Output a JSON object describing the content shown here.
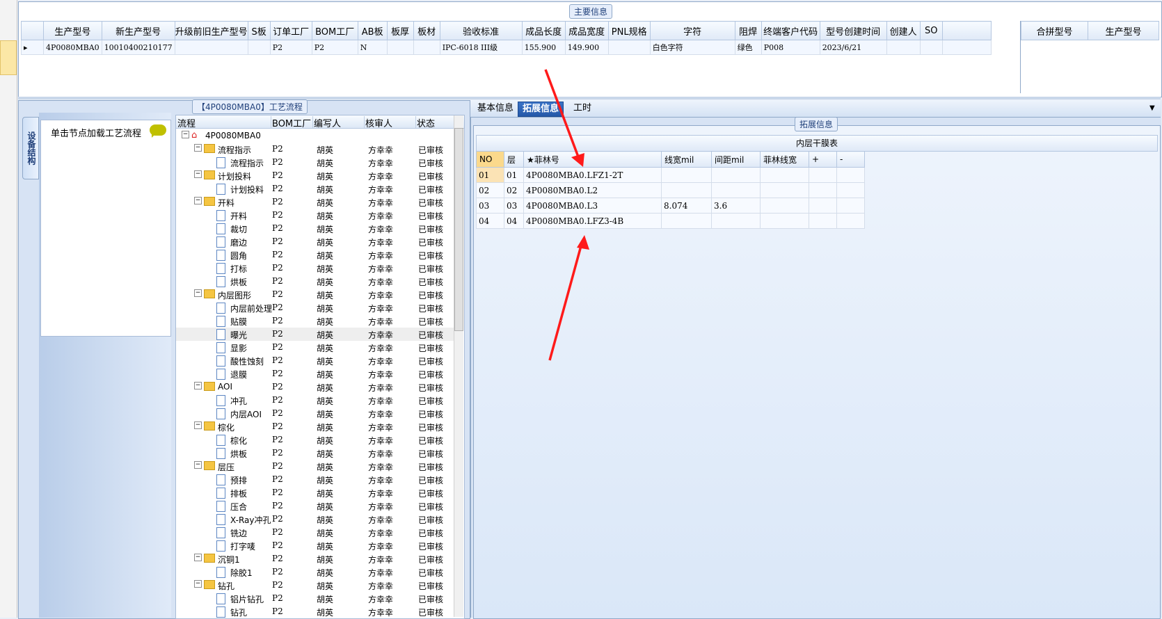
{
  "main_info": {
    "caption": "主要信息",
    "columns": [
      "生产型号",
      "新生产型号",
      "升级前旧生产型号",
      "S板",
      "订单工厂",
      "BOM工厂",
      "AB板",
      "板厚",
      "板材",
      "验收标准",
      "成品长度",
      "成品宽度",
      "PNL规格",
      "字符",
      "阻焊",
      "终端客户代码",
      "型号创建时间",
      "创建人",
      "SO"
    ],
    "rows": [
      [
        "4P0080MBA0",
        "10010400210177",
        "",
        "",
        "P2",
        "P2",
        "N",
        "",
        "",
        "IPC-6018 III级",
        "155.900",
        "149.900",
        "",
        "白色字符",
        "绿色",
        "P008",
        "2023/6/21",
        "",
        ""
      ]
    ],
    "row_indicator": "▸"
  },
  "merge": {
    "columns": [
      "合拼型号",
      "生产型号"
    ]
  },
  "process": {
    "caption": "【4P0080MBA0】工艺流程",
    "side_tab": "设备结构",
    "hint": "单击节点加载工艺流程",
    "columns": [
      "流程",
      "BOM工厂",
      "编写人",
      "核审人",
      "状态"
    ],
    "nodes": [
      {
        "name": "4P0080MBA0",
        "level": 0,
        "type": "root",
        "bom": "",
        "writer": "",
        "reviewer": "",
        "status": ""
      },
      {
        "name": "流程指示",
        "level": 1,
        "type": "folder",
        "bom": "P2",
        "writer": "胡英",
        "reviewer": "方幸幸",
        "status": "已审核"
      },
      {
        "name": "流程指示",
        "level": 2,
        "type": "doc",
        "bom": "P2",
        "writer": "胡英",
        "reviewer": "方幸幸",
        "status": "已审核"
      },
      {
        "name": "计划投料",
        "level": 1,
        "type": "folder",
        "bom": "P2",
        "writer": "胡英",
        "reviewer": "方幸幸",
        "status": "已审核"
      },
      {
        "name": "计划投料",
        "level": 2,
        "type": "doc",
        "bom": "P2",
        "writer": "胡英",
        "reviewer": "方幸幸",
        "status": "已审核"
      },
      {
        "name": "开料",
        "level": 1,
        "type": "folder",
        "bom": "P2",
        "writer": "胡英",
        "reviewer": "方幸幸",
        "status": "已审核"
      },
      {
        "name": "开料",
        "level": 2,
        "type": "doc",
        "bom": "P2",
        "writer": "胡英",
        "reviewer": "方幸幸",
        "status": "已审核"
      },
      {
        "name": "裁切",
        "level": 2,
        "type": "doc",
        "bom": "P2",
        "writer": "胡英",
        "reviewer": "方幸幸",
        "status": "已审核"
      },
      {
        "name": "磨边",
        "level": 2,
        "type": "doc",
        "bom": "P2",
        "writer": "胡英",
        "reviewer": "方幸幸",
        "status": "已审核"
      },
      {
        "name": "圆角",
        "level": 2,
        "type": "doc",
        "bom": "P2",
        "writer": "胡英",
        "reviewer": "方幸幸",
        "status": "已审核"
      },
      {
        "name": "打标",
        "level": 2,
        "type": "doc",
        "bom": "P2",
        "writer": "胡英",
        "reviewer": "方幸幸",
        "status": "已审核"
      },
      {
        "name": "烘板",
        "level": 2,
        "type": "doc",
        "bom": "P2",
        "writer": "胡英",
        "reviewer": "方幸幸",
        "status": "已审核"
      },
      {
        "name": "内层图形",
        "level": 1,
        "type": "folder",
        "bom": "P2",
        "writer": "胡英",
        "reviewer": "方幸幸",
        "status": "已审核"
      },
      {
        "name": "内层前处理",
        "level": 2,
        "type": "doc",
        "bom": "P2",
        "writer": "胡英",
        "reviewer": "方幸幸",
        "status": "已审核"
      },
      {
        "name": "贴膜",
        "level": 2,
        "type": "doc",
        "bom": "P2",
        "writer": "胡英",
        "reviewer": "方幸幸",
        "status": "已审核"
      },
      {
        "name": "曝光",
        "level": 2,
        "type": "doc",
        "bom": "P2",
        "writer": "胡英",
        "reviewer": "方幸幸",
        "status": "已审核",
        "selected": true
      },
      {
        "name": "显影",
        "level": 2,
        "type": "doc",
        "bom": "P2",
        "writer": "胡英",
        "reviewer": "方幸幸",
        "status": "已审核"
      },
      {
        "name": "酸性蚀刻",
        "level": 2,
        "type": "doc",
        "bom": "P2",
        "writer": "胡英",
        "reviewer": "方幸幸",
        "status": "已审核"
      },
      {
        "name": "退膜",
        "level": 2,
        "type": "doc",
        "bom": "P2",
        "writer": "胡英",
        "reviewer": "方幸幸",
        "status": "已审核"
      },
      {
        "name": "AOI",
        "level": 1,
        "type": "folder",
        "bom": "P2",
        "writer": "胡英",
        "reviewer": "方幸幸",
        "status": "已审核"
      },
      {
        "name": "冲孔",
        "level": 2,
        "type": "doc",
        "bom": "P2",
        "writer": "胡英",
        "reviewer": "方幸幸",
        "status": "已审核"
      },
      {
        "name": "内层AOI",
        "level": 2,
        "type": "doc",
        "bom": "P2",
        "writer": "胡英",
        "reviewer": "方幸幸",
        "status": "已审核"
      },
      {
        "name": "棕化",
        "level": 1,
        "type": "folder",
        "bom": "P2",
        "writer": "胡英",
        "reviewer": "方幸幸",
        "status": "已审核"
      },
      {
        "name": "棕化",
        "level": 2,
        "type": "doc",
        "bom": "P2",
        "writer": "胡英",
        "reviewer": "方幸幸",
        "status": "已审核"
      },
      {
        "name": "烘板",
        "level": 2,
        "type": "doc",
        "bom": "P2",
        "writer": "胡英",
        "reviewer": "方幸幸",
        "status": "已审核"
      },
      {
        "name": "层压",
        "level": 1,
        "type": "folder",
        "bom": "P2",
        "writer": "胡英",
        "reviewer": "方幸幸",
        "status": "已审核"
      },
      {
        "name": "预排",
        "level": 2,
        "type": "doc",
        "bom": "P2",
        "writer": "胡英",
        "reviewer": "方幸幸",
        "status": "已审核"
      },
      {
        "name": "排板",
        "level": 2,
        "type": "doc",
        "bom": "P2",
        "writer": "胡英",
        "reviewer": "方幸幸",
        "status": "已审核"
      },
      {
        "name": "压合",
        "level": 2,
        "type": "doc",
        "bom": "P2",
        "writer": "胡英",
        "reviewer": "方幸幸",
        "status": "已审核"
      },
      {
        "name": "X-Ray冲孔",
        "level": 2,
        "type": "doc",
        "bom": "P2",
        "writer": "胡英",
        "reviewer": "方幸幸",
        "status": "已审核"
      },
      {
        "name": "铣边",
        "level": 2,
        "type": "doc",
        "bom": "P2",
        "writer": "胡英",
        "reviewer": "方幸幸",
        "status": "已审核"
      },
      {
        "name": "打字唛",
        "level": 2,
        "type": "doc",
        "bom": "P2",
        "writer": "胡英",
        "reviewer": "方幸幸",
        "status": "已审核"
      },
      {
        "name": "沉铜1",
        "level": 1,
        "type": "folder",
        "bom": "P2",
        "writer": "胡英",
        "reviewer": "方幸幸",
        "status": "已审核"
      },
      {
        "name": "除胶1",
        "level": 2,
        "type": "doc",
        "bom": "P2",
        "writer": "胡英",
        "reviewer": "方幸幸",
        "status": "已审核"
      },
      {
        "name": "钻孔",
        "level": 1,
        "type": "folder",
        "bom": "P2",
        "writer": "胡英",
        "reviewer": "方幸幸",
        "status": "已审核"
      },
      {
        "name": "铝片钻孔",
        "level": 2,
        "type": "doc",
        "bom": "P2",
        "writer": "胡英",
        "reviewer": "方幸幸",
        "status": "已审核"
      },
      {
        "name": "钻孔",
        "level": 2,
        "type": "doc",
        "bom": "P2",
        "writer": "胡英",
        "reviewer": "方幸幸",
        "status": "已审核"
      }
    ]
  },
  "tabs": [
    {
      "label": "基本信息",
      "active": false
    },
    {
      "label": "拓展信息",
      "active": true
    },
    {
      "label": "工时",
      "active": false
    }
  ],
  "extended": {
    "caption": "拓展信息",
    "table_title": "内层干膜表",
    "columns": [
      "NO",
      "层",
      "★菲林号",
      "线宽mil",
      "间距mil",
      "菲林线宽",
      "+",
      "-"
    ],
    "rows": [
      [
        "01",
        "01",
        "4P0080MBA0.LFZ1-2T",
        "",
        "",
        "",
        "",
        ""
      ],
      [
        "02",
        "02",
        "4P0080MBA0.L2",
        "",
        "",
        "",
        "",
        ""
      ],
      [
        "03",
        "03",
        "4P0080MBA0.L3",
        "8.074",
        "3.6",
        "",
        "",
        ""
      ],
      [
        "04",
        "04",
        "4P0080MBA0.LFZ3-4B",
        "",
        "",
        "",
        "",
        ""
      ]
    ]
  },
  "colors": {
    "accent": "#2458a8",
    "arrow": "#ff1a1a",
    "panel": "#d7e3f4"
  },
  "icons": [
    "folder-icon",
    "document-icon",
    "home-icon",
    "expand-icon",
    "speech-bubble-icon",
    "dropdown-arrow-icon"
  ]
}
